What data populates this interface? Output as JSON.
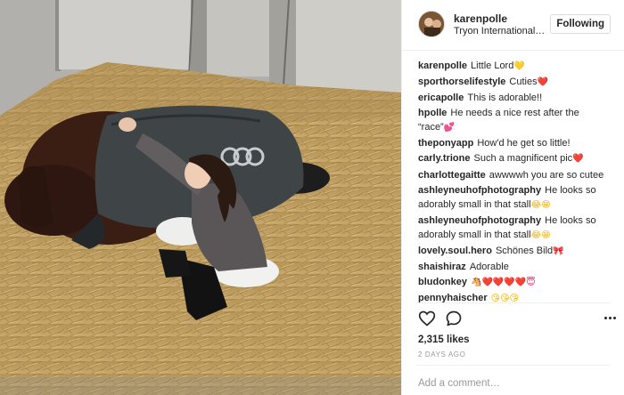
{
  "post": {
    "photo_alt": "Girl in grey jacket petting a dark horse lying in straw",
    "header": {
      "username": "karenpolle",
      "location": "Tryon International…",
      "follow_label": "Following"
    },
    "comments": [
      {
        "user": "karenpolle",
        "text": "Little Lord",
        "emoji": "💛",
        "emoji_class": "e-yel"
      },
      {
        "user": "sporthorselifestyle",
        "text": "Cuties",
        "emoji": "❤️",
        "emoji_class": "e-red"
      },
      {
        "user": "ericapolle",
        "text": "This is adorable!!",
        "emoji": "",
        "emoji_class": ""
      },
      {
        "user": "hpolle",
        "text": "He needs a nice rest after the “race”",
        "emoji": "💕",
        "emoji_class": "e-pink"
      },
      {
        "user": "theponyapp",
        "text": "How'd he get so little!",
        "emoji": "",
        "emoji_class": ""
      },
      {
        "user": "carly.trione",
        "text": "Such a magnificent pic",
        "emoji": "❤️",
        "emoji_class": "e-red"
      },
      {
        "user": "charlottegaitte",
        "text": "awwwwh you are so cutee",
        "emoji": "",
        "emoji_class": ""
      },
      {
        "user": "ashleyneuhofphotography",
        "text": "He looks so adorably small in that stall",
        "emoji": "😂😁",
        "emoji_class": "e-face"
      },
      {
        "user": "ashleyneuhofphotography",
        "text": "He looks so adorably small in that stall",
        "emoji": "😂😁",
        "emoji_class": "e-face"
      },
      {
        "user": "lovely.soul.hero",
        "text": "Schönes Bild",
        "emoji": "🎀",
        "emoji_class": "e-pink"
      },
      {
        "user": "shaishiraz",
        "text": "Adorable",
        "emoji": "",
        "emoji_class": ""
      },
      {
        "user": "bludonkey",
        "text": "",
        "emoji": "🐴❤️❤️❤️❤️😇",
        "emoji_class": "e-red"
      },
      {
        "user": "pennyhaischer",
        "text": "",
        "emoji": "😘😘😘",
        "emoji_class": "e-face"
      }
    ],
    "icons": {
      "like": "heart-outline-icon",
      "comment": "speech-bubble-icon",
      "more": "more-options-icon"
    },
    "likes_label": "2,315 likes",
    "date_label": "2 DAYS AGO",
    "comment_input": {
      "placeholder": "Add a comment…",
      "value": ""
    }
  }
}
